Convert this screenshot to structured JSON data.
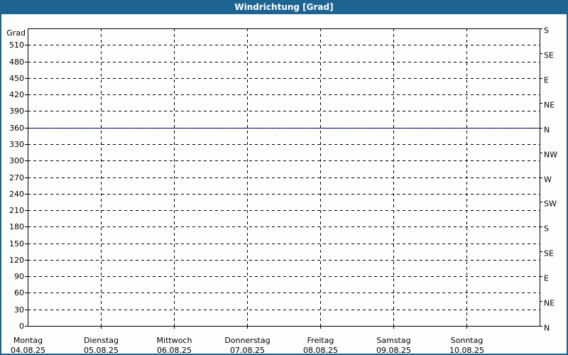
{
  "title_bar": {
    "label": "Windrichtung [Grad]",
    "bg_color": "#1d6493",
    "text_color": "#ffffff"
  },
  "chart_data": {
    "type": "line",
    "title": "Windrichtung [Grad]",
    "grid": {
      "style": "dashed",
      "color": "#000000",
      "horizontal_step": 30,
      "vertical": "one-per-day"
    },
    "y_axis_left": {
      "label": "Grad",
      "min": 0,
      "max": 540,
      "tick_step": 30,
      "tick_labels": [
        "0",
        "30",
        "60",
        "90",
        "120",
        "150",
        "180",
        "210",
        "240",
        "270",
        "300",
        "330",
        "360",
        "390",
        "420",
        "450",
        "480",
        "510"
      ]
    },
    "y_axis_right": {
      "tick_step": 45,
      "ticks": [
        {
          "value": 0,
          "label": "N"
        },
        {
          "value": 45,
          "label": "NE"
        },
        {
          "value": 90,
          "label": "E"
        },
        {
          "value": 135,
          "label": "SE"
        },
        {
          "value": 180,
          "label": "S"
        },
        {
          "value": 225,
          "label": "SW"
        },
        {
          "value": 270,
          "label": "W"
        },
        {
          "value": 315,
          "label": "NW"
        },
        {
          "value": 360,
          "label": "N"
        },
        {
          "value": 405,
          "label": "NE"
        },
        {
          "value": 450,
          "label": "E"
        },
        {
          "value": 495,
          "label": "SE"
        },
        {
          "value": 540,
          "label": "S"
        }
      ]
    },
    "x_axis": {
      "days": [
        {
          "name": "Montag",
          "date": "04.08.25"
        },
        {
          "name": "Dienstag",
          "date": "05.08.25"
        },
        {
          "name": "Mittwoch",
          "date": "06.08.25"
        },
        {
          "name": "Donnerstag",
          "date": "07.08.25"
        },
        {
          "name": "Freitag",
          "date": "08.08.25"
        },
        {
          "name": "Samstag",
          "date": "09.08.25"
        },
        {
          "name": "Sonntag",
          "date": "10.08.25"
        }
      ]
    },
    "series": [
      {
        "name": "Windrichtung",
        "color": "#0000cc",
        "constant_value": 360,
        "values": [
          360,
          360,
          360,
          360,
          360,
          360,
          360,
          360
        ]
      }
    ],
    "legend": "none",
    "ylim": [
      0,
      540
    ]
  }
}
